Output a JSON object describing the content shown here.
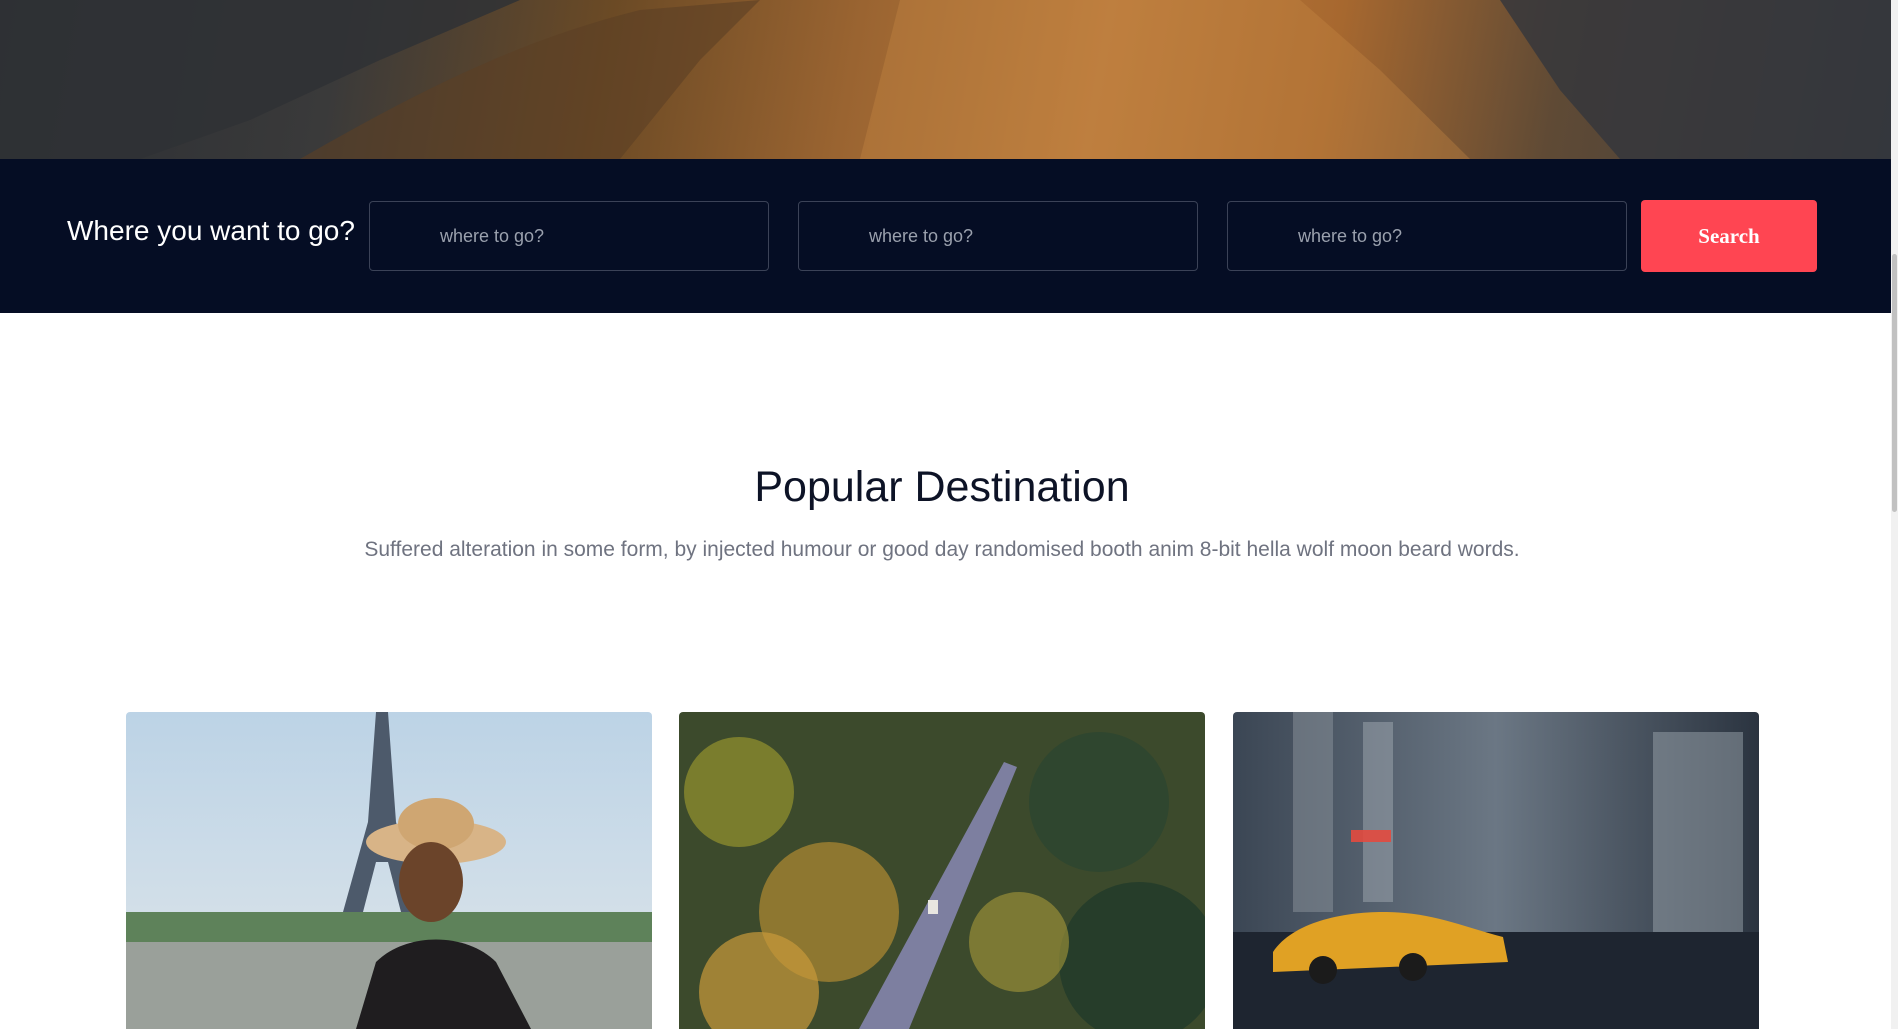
{
  "search": {
    "title": "Where you want to go?",
    "field_1_placeholder": "where to go?",
    "field_2_placeholder": "where to go?",
    "field_3_placeholder": "where to go?",
    "button_label": "Search"
  },
  "popular": {
    "title": "Popular Destination",
    "subtitle": "Suffered alteration in some form, by injected humour or good day randomised booth anim 8-bit hella wolf moon beard words."
  },
  "cards": [
    {
      "image": "paris-eiffel-tower-photo"
    },
    {
      "image": "forest-road-aerial-photo"
    },
    {
      "image": "city-taxi-photo"
    }
  ],
  "colors": {
    "search_bar_bg": "#050d24",
    "accent": "#ff4552"
  }
}
